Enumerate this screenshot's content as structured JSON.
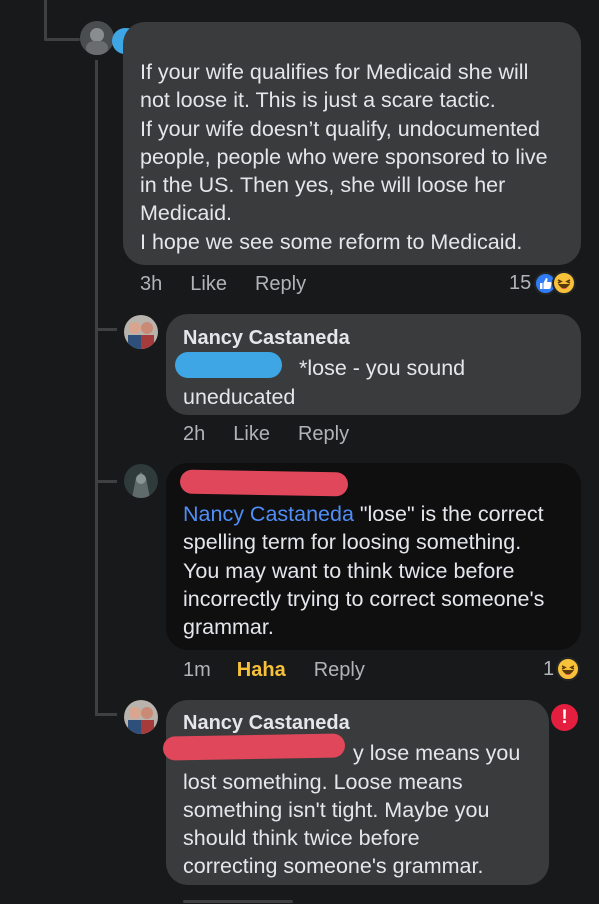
{
  "comments": [
    {
      "text": "If your wife qualifies for Medicaid she will not loose it.  This is just a scare tactic. If your wife doesn’t qualify, undocumented people, people who were sponsored to live in the US.  Then yes, she will loose her Medicaid. I hope we see some reform to Medicaid.",
      "lines": [
        "If your wife qualifies for Medicaid she will",
        "not loose it.  This is just a scare tactic.",
        "If your wife doesn’t qualify, undocumented",
        "people, people who were sponsored to live",
        "in the US.  Then yes, she will loose her",
        "Medicaid.",
        "I hope we see some reform to Medicaid."
      ],
      "time": "3h",
      "like": "Like",
      "reply": "Reply",
      "reaction_count": "15",
      "reaction_icons": [
        "like-icon",
        "haha-icon"
      ]
    },
    {
      "author": "Nancy Castaneda",
      "text_after_redaction": "*lose - you sound",
      "text_line2": "uneducated",
      "time": "2h",
      "like": "Like",
      "reply": "Reply"
    },
    {
      "mention": "Nancy Castaneda",
      "line1_rest": " \"lose\" is the correct",
      "lines": [
        "spelling term for loosing something.",
        "You may want to think twice before",
        "incorrectly trying to correct someone's",
        "grammar."
      ],
      "time": "1m",
      "reaction_label": "Haha",
      "reply": "Reply",
      "reaction_count": "1",
      "reaction_icons": [
        "haha-icon"
      ]
    },
    {
      "author": "Nancy Castaneda",
      "line1_rest": "y lose means you",
      "lines": [
        "lost something. Loose means",
        "something isn't tight. Maybe you",
        "should think twice before",
        "correcting someone's grammar."
      ],
      "warning_icon": "!"
    }
  ],
  "colors": {
    "background": "#18191a",
    "bubble": "#3a3b3c",
    "bubble_selected": "#0f0f10",
    "mention": "#4f8ef7",
    "haha": "#f7c13a",
    "like_blue": "#2f7cf6",
    "warning": "#e41e3f",
    "redaction_blue": "#3fa6e6",
    "redaction_red": "#e0475a"
  }
}
